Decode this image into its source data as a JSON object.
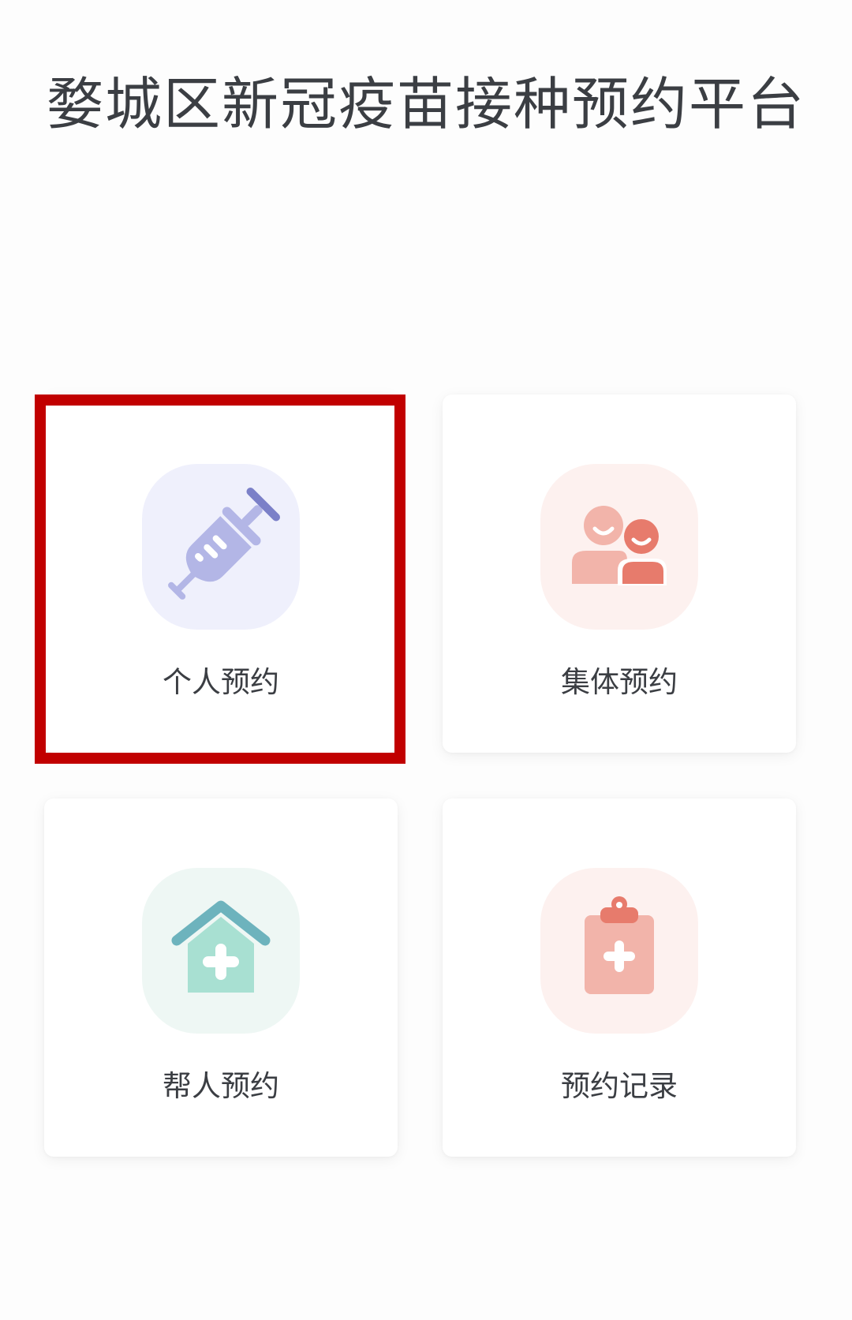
{
  "header": {
    "title": "婺城区新冠疫苗接种预约平台"
  },
  "menu": {
    "items": [
      {
        "label": "个人预约",
        "icon": "syringe-icon",
        "tile_color": "#eff0fc",
        "icon_color": "#b3b6e6",
        "accent_color": "#7b80c8"
      },
      {
        "label": "集体预约",
        "icon": "group-people-icon",
        "tile_color": "#fdf1ef",
        "icon_color": "#f2b4aa",
        "accent_color": "#e77b6c"
      },
      {
        "label": "帮人预约",
        "icon": "house-plus-icon",
        "tile_color": "#eef7f4",
        "icon_color": "#a8e0d2",
        "accent_color": "#6db3bd"
      },
      {
        "label": "预约记录",
        "icon": "clipboard-plus-icon",
        "tile_color": "#fdf1ef",
        "icon_color": "#f2b4aa",
        "accent_color": "#e77b6c"
      }
    ]
  },
  "highlight": {
    "color": "#c10000"
  }
}
